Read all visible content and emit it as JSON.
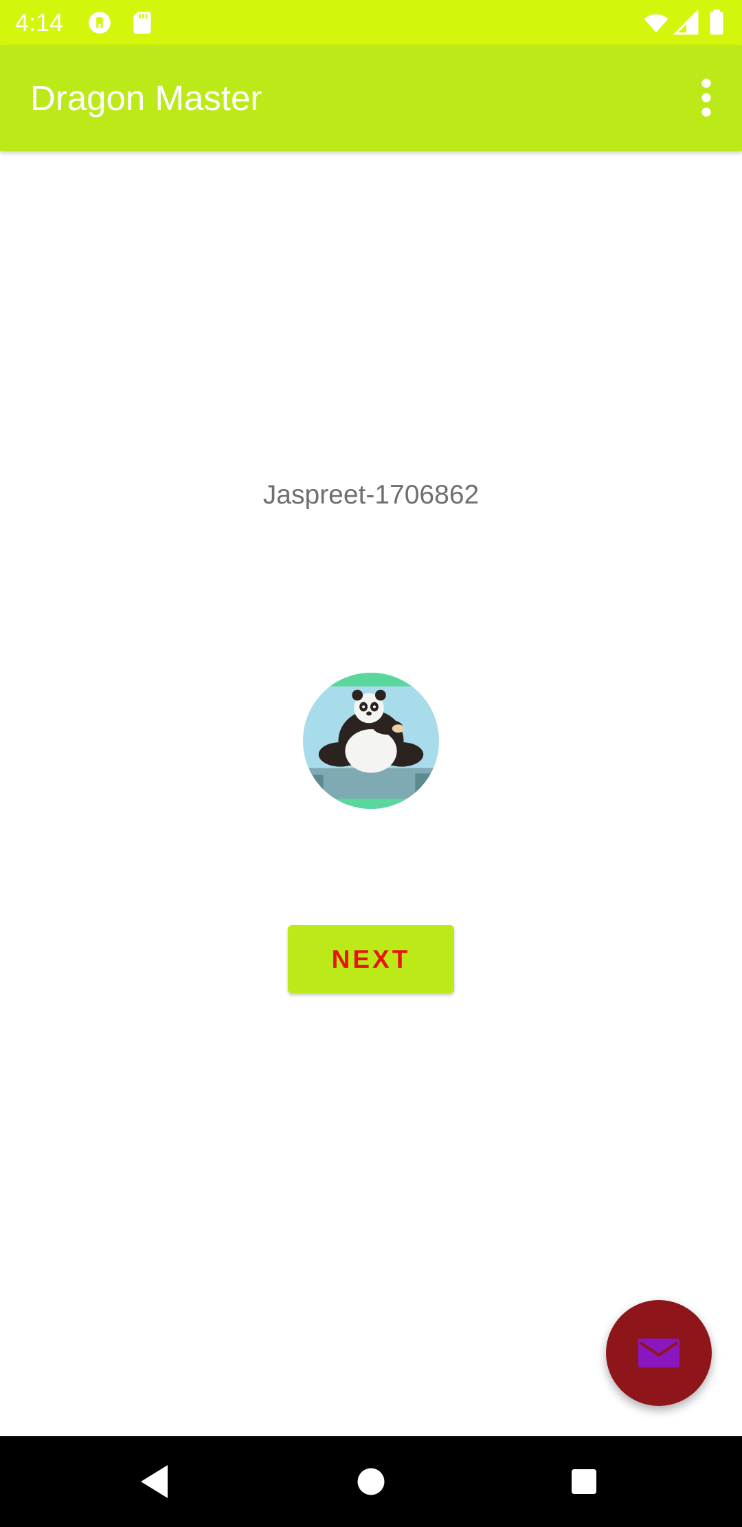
{
  "status_bar": {
    "time": "4:14",
    "icons": [
      "notification-icon",
      "sd-card-icon",
      "wifi-icon",
      "signal-icon",
      "battery-icon"
    ]
  },
  "app_bar": {
    "title": "Dragon Master",
    "overflow_icon": "more-vert-icon"
  },
  "main": {
    "user_label": "Jaspreet-1706862",
    "avatar_icon": "panda-avatar-image",
    "next_button_label": "NEXT"
  },
  "fab": {
    "icon": "email-icon"
  },
  "nav_bar": {
    "back_icon": "back-icon",
    "home_icon": "home-icon",
    "recents_icon": "recents-icon"
  },
  "colors": {
    "status_bar": "#d4f50c",
    "app_bar": "#bcea18",
    "button": "#bcea18",
    "button_text": "#e8140c",
    "fab": "#8e161a",
    "fab_icon": "#8a16c0"
  }
}
